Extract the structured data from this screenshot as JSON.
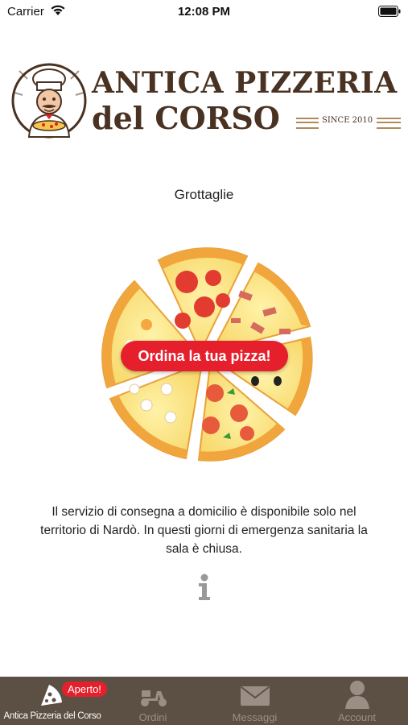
{
  "status_bar": {
    "carrier": "Carrier",
    "time": "12:08 PM"
  },
  "logo": {
    "line1": "ANTICA PIZZERIA",
    "line2": "del CORSO",
    "since": "SINCE 2010"
  },
  "location": "Grottaglie",
  "order_button": "Ordina la tua pizza!",
  "info_text": "Il servizio di consegna a domicilio è disponibile solo nel territorio di Nardò. In questi giorni di emergenza sanitaria la sala è chiusa.",
  "tabs": [
    {
      "label": "Antica Pizzeria del Corso",
      "icon": "pizza-slice-icon",
      "badge": "Aperto!",
      "active": true
    },
    {
      "label": "Ordini",
      "icon": "scooter-icon",
      "active": false
    },
    {
      "label": "Messaggi",
      "icon": "envelope-icon",
      "active": false
    },
    {
      "label": "Account",
      "icon": "person-icon",
      "active": false
    }
  ],
  "colors": {
    "tab_bar": "#5c4f44",
    "accent_red": "#e5202c",
    "brand_brown": "#4a3222"
  }
}
